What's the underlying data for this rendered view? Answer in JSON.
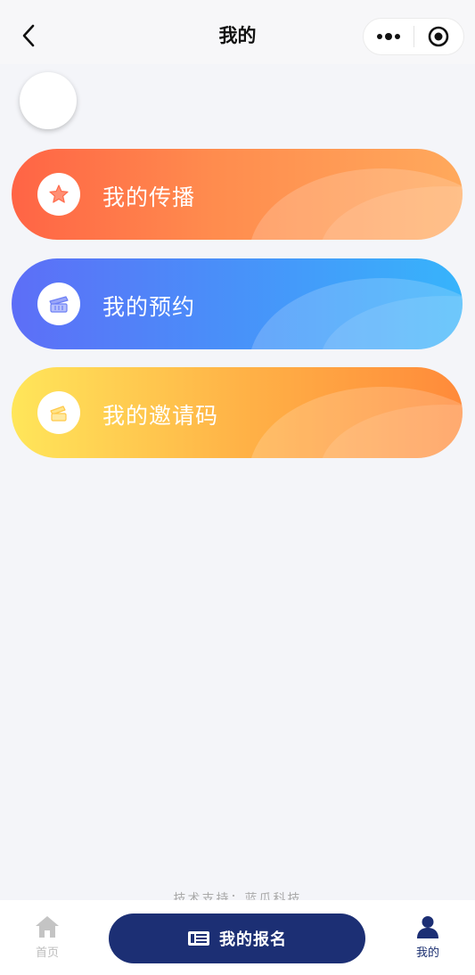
{
  "nav": {
    "title": "我的",
    "back_icon": "chevron-left-icon",
    "more_icon": "more-dots-icon",
    "close_icon": "target-circle-icon"
  },
  "menu": [
    {
      "label": "我的传播",
      "icon": "star-icon",
      "gradient": [
        "#ff6445",
        "#ffa95c"
      ],
      "icon_color": "#ff7a5c"
    },
    {
      "label": "我的预约",
      "icon": "calendar-tag-icon",
      "gradient": [
        "#5d6ef7",
        "#37b4fb"
      ],
      "icon_color": "#6c7ff5"
    },
    {
      "label": "我的邀请码",
      "icon": "ticket-icon",
      "gradient": [
        "#ffe65a",
        "#ff8a3a"
      ],
      "icon_color": "#ffd24a"
    }
  ],
  "footer": {
    "credit": "技术支持：蓝瓜科技"
  },
  "tabbar": {
    "home_label": "首页",
    "signup_label": "我的报名",
    "mine_label": "我的",
    "accent": "#1c2f74",
    "inactive": "#bdbdbd"
  }
}
